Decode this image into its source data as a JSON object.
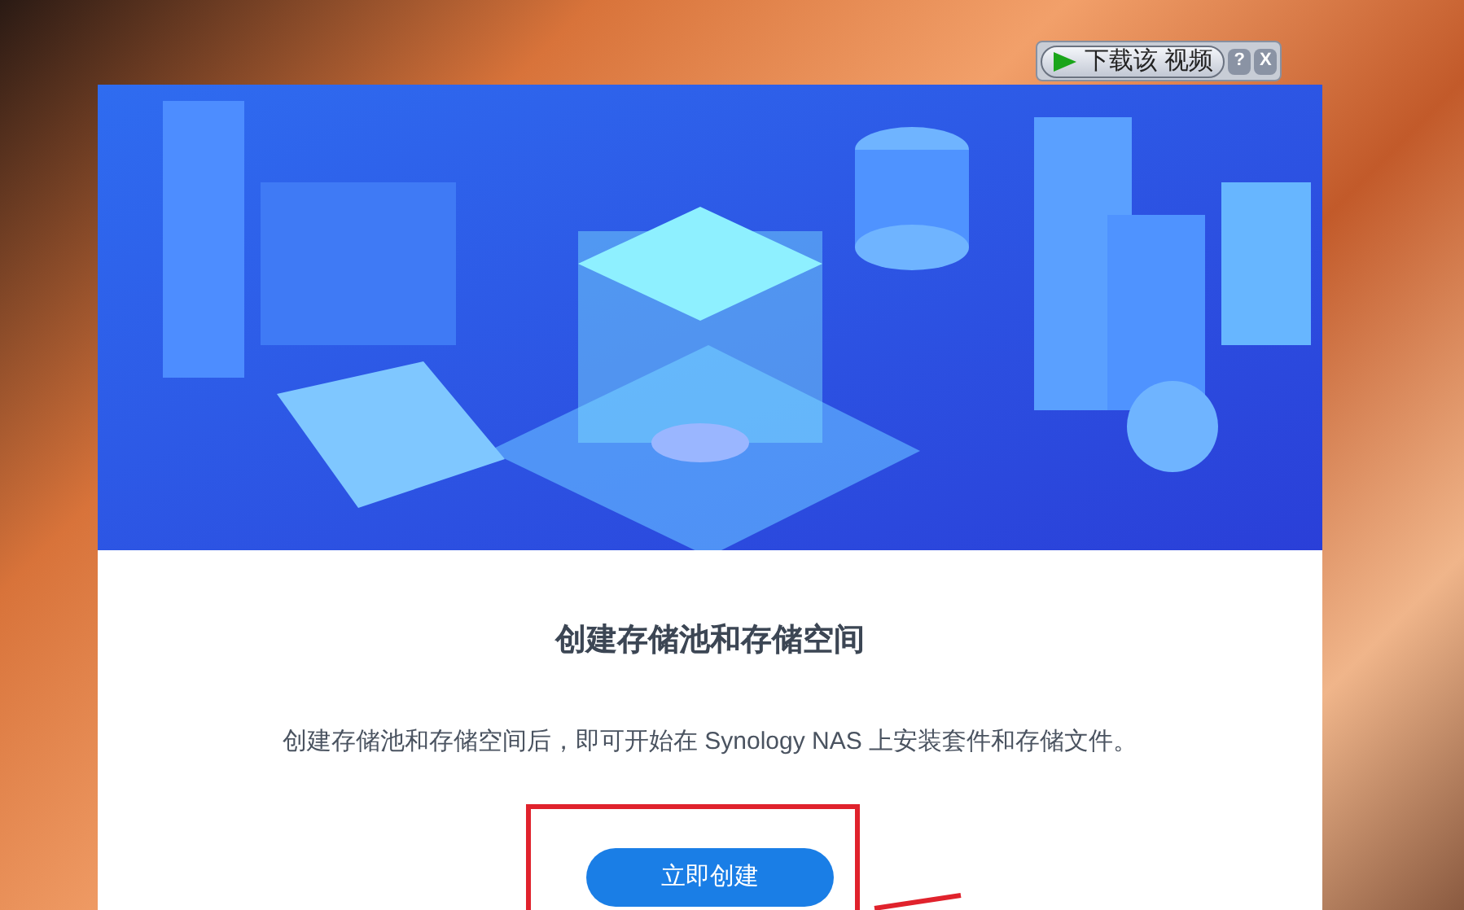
{
  "video_toolbar": {
    "download_label": "下载该 视频",
    "help": "?",
    "close": "X"
  },
  "dialog": {
    "title": "创建存储池和存储空间",
    "description": "创建存储池和存储空间后，即可开始在 Synology NAS 上安装套件和存储文件。",
    "primary_button": "立即创建"
  }
}
